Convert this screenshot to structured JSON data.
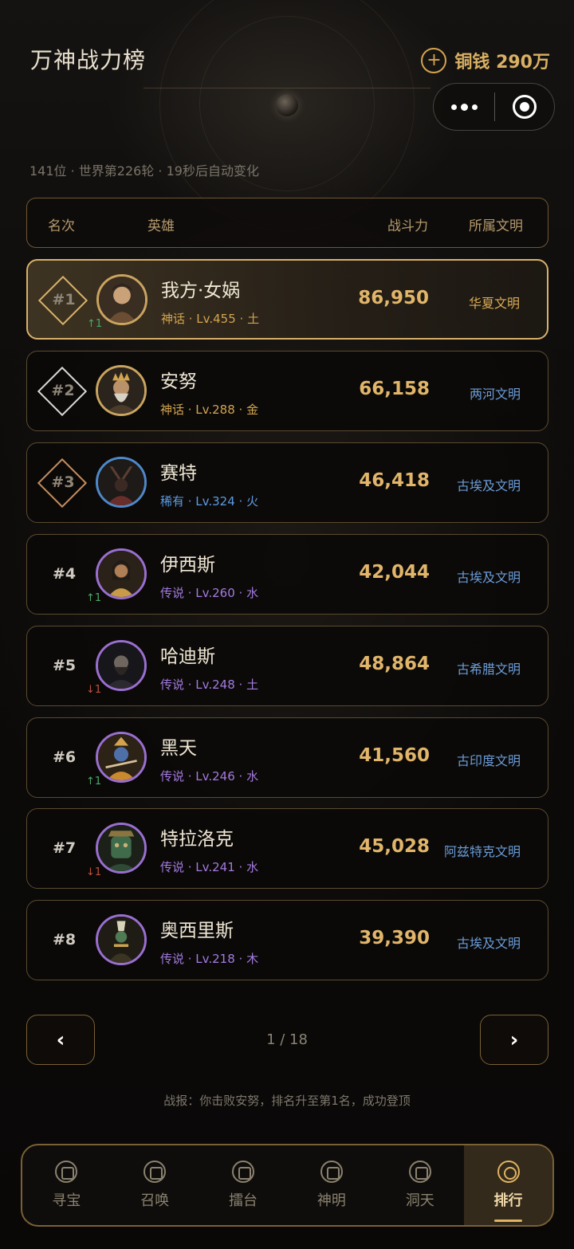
{
  "header": {
    "title": "万神战力榜",
    "coins_text": "铜钱 290万",
    "add_symbol": "+"
  },
  "subinfo": "141位 · 世界第226轮 · 19秒后自动变化",
  "columns": {
    "rank": "名次",
    "hero": "英雄",
    "power": "战斗力",
    "civ": "所属文明"
  },
  "rows": [
    {
      "rank": "#1",
      "trend": "↑1",
      "name": "我方·女娲",
      "meta": "神话 · Lv.455 · 土",
      "power": "86,950",
      "civ": "华夏文明"
    },
    {
      "rank": "#2",
      "trend": "",
      "name": "安努",
      "meta": "神话 · Lv.288 · 金",
      "power": "66,158",
      "civ": "两河文明"
    },
    {
      "rank": "#3",
      "trend": "",
      "name": "赛特",
      "meta": "稀有 · Lv.324 · 火",
      "power": "46,418",
      "civ": "古埃及文明"
    },
    {
      "rank": "#4",
      "trend": "↑1",
      "name": "伊西斯",
      "meta": "传说 · Lv.260 · 水",
      "power": "42,044",
      "civ": "古埃及文明"
    },
    {
      "rank": "#5",
      "trend": "↓1",
      "name": "哈迪斯",
      "meta": "传说 · Lv.248 · 土",
      "power": "48,864",
      "civ": "古希腊文明"
    },
    {
      "rank": "#6",
      "trend": "↑1",
      "name": "黑天",
      "meta": "传说 · Lv.246 · 水",
      "power": "41,560",
      "civ": "古印度文明"
    },
    {
      "rank": "#7",
      "trend": "↓1",
      "name": "特拉洛克",
      "meta": "传说 · Lv.241 · 水",
      "power": "45,028",
      "civ": "阿兹特克文明"
    },
    {
      "rank": "#8",
      "trend": "",
      "name": "奥西里斯",
      "meta": "传说 · Lv.218 · 木",
      "power": "39,390",
      "civ": "古埃及文明"
    }
  ],
  "pager": {
    "prev": "‹",
    "next": "›",
    "text": "1 / 18"
  },
  "report": "战报：你击败安努，排名升至第1名，成功登顶",
  "tabs": [
    "寻宝",
    "召唤",
    "擂台",
    "神明",
    "洞天",
    "排行"
  ],
  "colors": {
    "accent_gold": "#d8b06a",
    "rarity_mythic": "#d3a44f",
    "rarity_rare": "#5c9be0",
    "rarity_legend": "#a47ae0",
    "trend_up": "#4ba86a",
    "trend_down": "#c0503c"
  },
  "icons": {
    "coin_add": "plus-circle-icon",
    "capsule_more": "more-dots-icon",
    "capsule_close": "target-close-icon",
    "tabs": [
      "treasure-icon",
      "summon-icon",
      "arena-icon",
      "deity-icon",
      "realm-icon",
      "ranking-icon"
    ]
  },
  "active_tab": 5
}
